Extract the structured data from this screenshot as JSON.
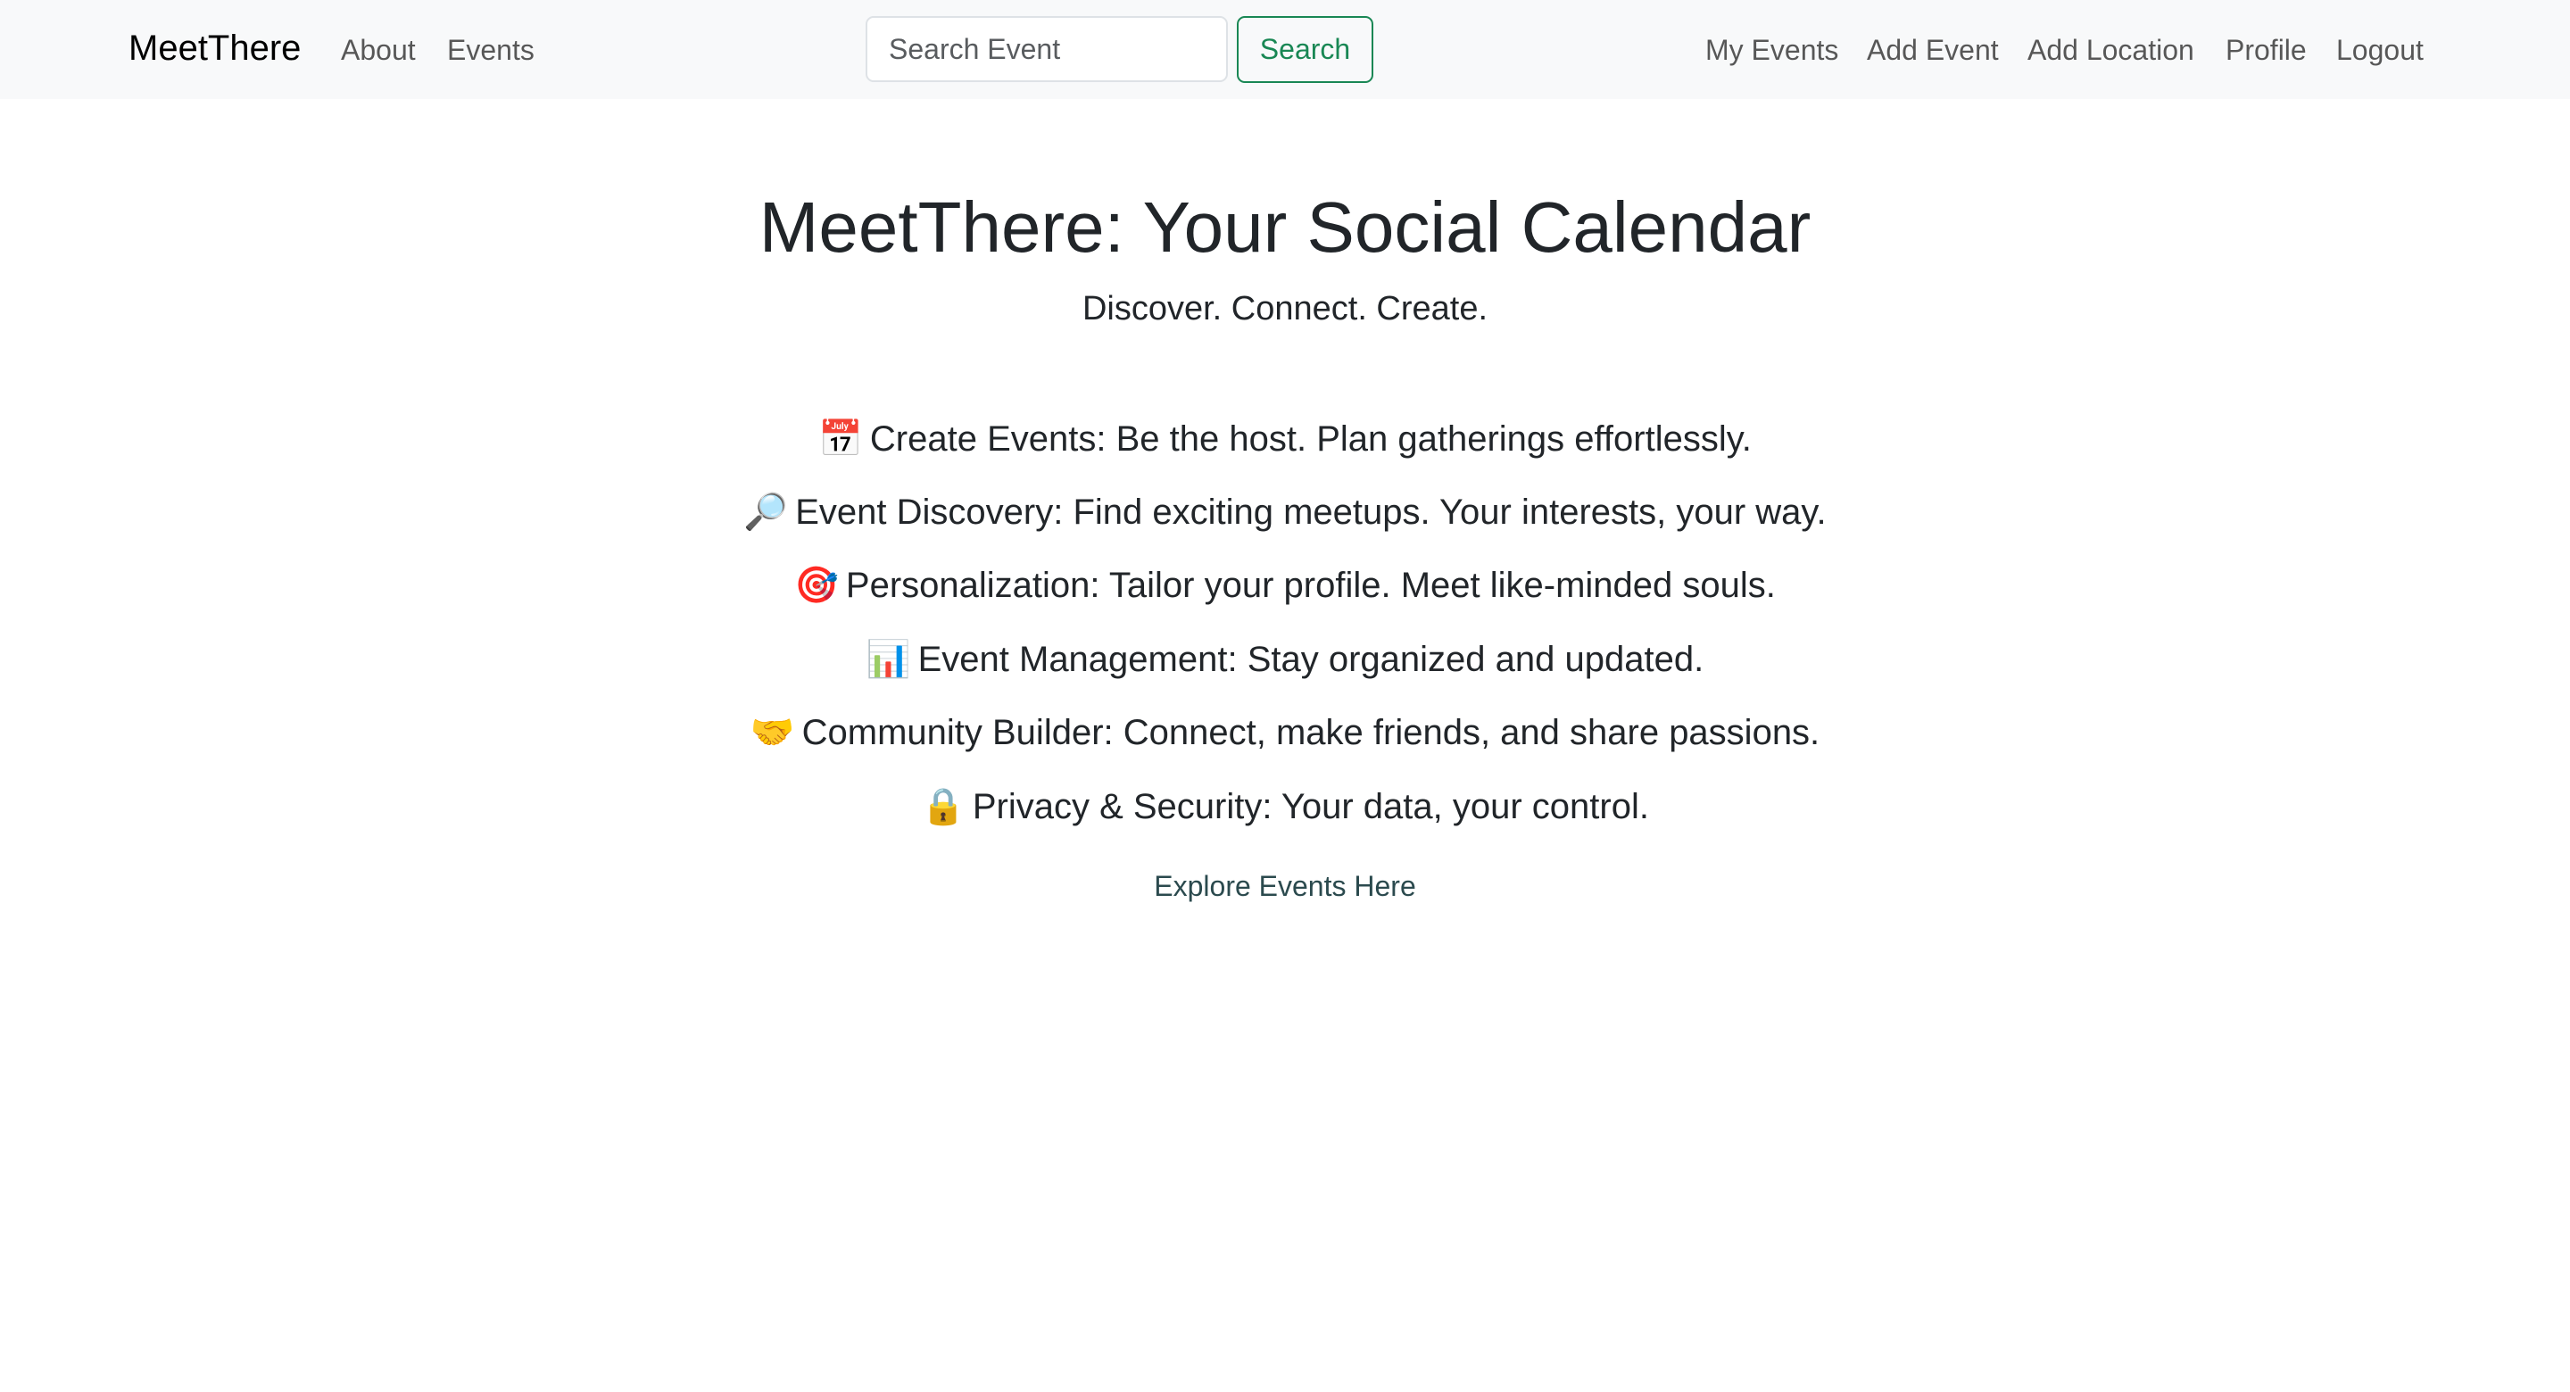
{
  "navbar": {
    "brand": "MeetThere",
    "left_links": [
      {
        "label": "About"
      },
      {
        "label": "Events"
      }
    ],
    "search": {
      "placeholder": "Search Event",
      "value": "",
      "button_label": "Search"
    },
    "right_links": [
      {
        "label": "My Events"
      },
      {
        "label": "Add Event"
      },
      {
        "label": "Add Location"
      },
      {
        "label": "Profile"
      },
      {
        "label": "Logout"
      }
    ]
  },
  "hero": {
    "title": "MeetThere: Your Social Calendar",
    "subtitle": "Discover. Connect. Create."
  },
  "features": [
    {
      "icon": "calendar-icon",
      "emoji": "📅",
      "text": "Create Events: Be the host. Plan gatherings effortlessly."
    },
    {
      "icon": "magnifier-icon",
      "emoji": "🔎",
      "text": "Event Discovery: Find exciting meetups. Your interests, your way."
    },
    {
      "icon": "target-icon",
      "emoji": "🎯",
      "text": "Personalization: Tailor your profile. Meet like-minded souls."
    },
    {
      "icon": "bar-chart-icon",
      "emoji": "📊",
      "text": "Event Management: Stay organized and updated."
    },
    {
      "icon": "handshake-icon",
      "emoji": "🤝",
      "text": "Community Builder: Connect, make friends, and share passions."
    },
    {
      "icon": "lock-icon",
      "emoji": "🔒",
      "text": "Privacy & Security: Your data, your control."
    }
  ],
  "explore_link": "Explore Events Here",
  "colors": {
    "navbar_bg": "#f8f9fa",
    "search_button": "#198754",
    "explore_link": "#2b4a4e"
  }
}
